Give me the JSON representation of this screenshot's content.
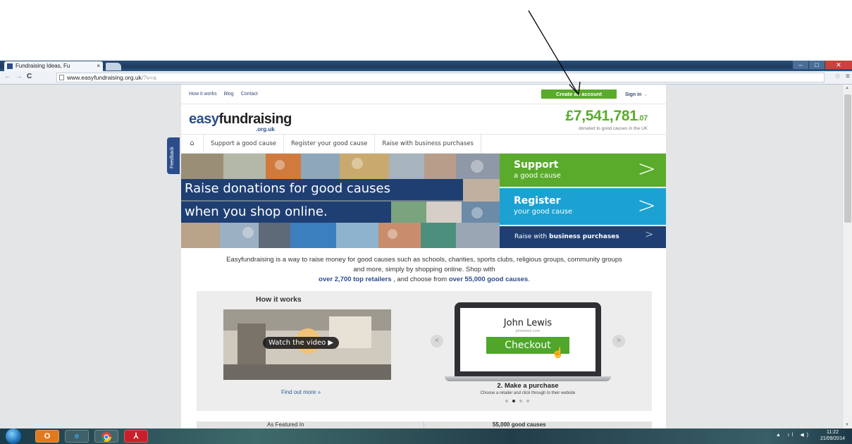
{
  "browser": {
    "tab_title": "Fundraising Ideas, Fu",
    "tab_close": "×",
    "url_host": "www.easyfundraising.org.uk",
    "url_path": "/?v=a"
  },
  "site": {
    "toplinks": [
      "How it works",
      "Blog",
      "Contact"
    ],
    "create_account": "Create an account",
    "sign_in": "Sign in",
    "logo_easy": "easy",
    "logo_fund": "fundraising",
    "logo_sub": ".org.uk",
    "total_main": "£7,541,781",
    "total_pence": ".07",
    "total_caption": "donated to good causes in the UK",
    "nav": [
      "Support a good cause",
      "Register your good cause",
      "Raise with business purchases"
    ],
    "feedback": "Feedback",
    "hero_line1": "Raise donations for good causes",
    "hero_line2": "when you shop online.",
    "cta": {
      "support_big": "Support",
      "support_small": "a good cause",
      "register_big": "Register",
      "register_small": "your good cause",
      "business_pre": "Raise with ",
      "business_bold": "business purchases",
      "chev": ">"
    },
    "intro": {
      "part1": "Easyfundraising is a way to raise money for good causes such as schools, charities, sports clubs, religious groups, community groups and more, simply by shopping online. Shop with",
      "retailers": "over 2,700 top retailers",
      "part2": ", and choose from",
      "causes": "over 55,000 good causes",
      "end": "."
    },
    "how": {
      "title": "How it works",
      "watch": "Watch the video ▶",
      "find_more": "Find out more »",
      "shop": "John Lewis",
      "shop_url": "johnlewis.com",
      "checkout": "Checkout",
      "step_title": "2. Make a purchase",
      "step_desc": "Choose a retailer and click through to their website",
      "prev": "<",
      "next": ">"
    },
    "bottom": {
      "featured": "As Featured In",
      "causes": "55,000 good causes"
    }
  },
  "taskbar": {
    "time": "11:22",
    "date": "21/09/2014"
  },
  "colors": {
    "green": "#5aab2b",
    "blue": "#1ba2d2",
    "navy": "#1f3f73"
  }
}
